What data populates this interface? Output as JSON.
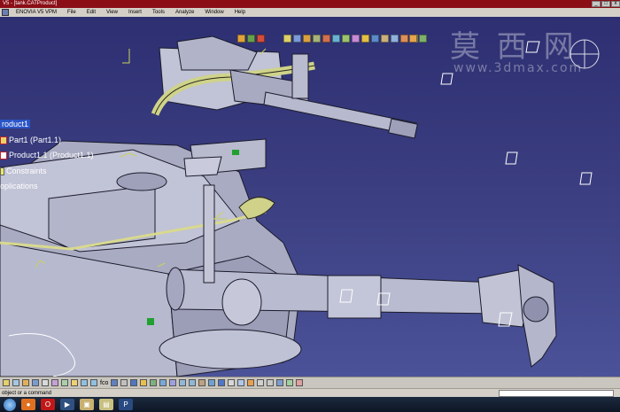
{
  "window": {
    "title": "V5 - [tank.CATProduct]",
    "controls": [
      "_",
      "□",
      "x"
    ]
  },
  "menu": {
    "items": [
      "ENOVIA V5 VPM",
      "File",
      "Edit",
      "View",
      "Insert",
      "Tools",
      "Analyze",
      "Window",
      "Help"
    ]
  },
  "tree": {
    "root": "roduct1",
    "children": [
      {
        "label": "Part1 (Part1.1)",
        "icon": "part-icon"
      },
      {
        "label": "Product1.1 (Product1.1)",
        "icon": "product-icon"
      },
      {
        "label": "Constraints",
        "icon": "constraints-icon"
      },
      {
        "label": "oplications",
        "icon": "applications-icon"
      }
    ]
  },
  "watermark": {
    "line1": "莫 西 网",
    "line2": "www.3dmax.com"
  },
  "status": {
    "prompt": "object or a command"
  },
  "bottom_toolbar": {
    "label": "fco"
  },
  "taskbar": {
    "items": [
      "start-button",
      "firefox-icon",
      "opera-icon",
      "windows-media-icon",
      "catia-icon",
      "explorer-icon",
      "photoshop-icon"
    ]
  },
  "colors": {
    "background_top": "#2d2f72",
    "background_bottom": "#4b5298",
    "title_bar": "#8b0e17",
    "selection": "#2a55c8",
    "model_gray": "#aeb0c4",
    "model_yellow": "#c6c98f"
  }
}
